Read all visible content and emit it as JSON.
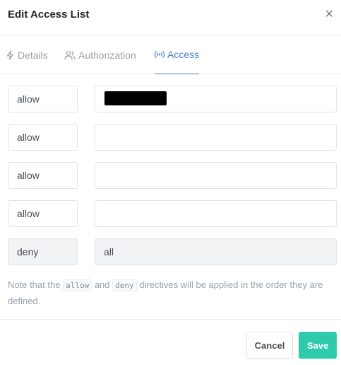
{
  "modal": {
    "title": "Edit Access List",
    "close_glyph": "×"
  },
  "tabs": [
    {
      "label": "Details",
      "icon": "bolt-icon",
      "active": false
    },
    {
      "label": "Authorization",
      "icon": "users-icon",
      "active": false
    },
    {
      "label": "Access",
      "icon": "broadcast-icon",
      "active": true
    }
  ],
  "rules": [
    {
      "directive": "allow",
      "address": "",
      "redacted": true
    },
    {
      "directive": "allow",
      "address": ""
    },
    {
      "directive": "allow",
      "address": ""
    },
    {
      "directive": "allow",
      "address": ""
    },
    {
      "directive": "deny",
      "address": "all",
      "disabled": true
    }
  ],
  "note": {
    "prefix": "Note that the",
    "code1": "allow",
    "middle": "and",
    "code2": "deny",
    "suffix": "directives will be applied in the order they are defined."
  },
  "footer": {
    "cancel_label": "Cancel",
    "save_label": "Save"
  },
  "colors": {
    "accent": "#467fcf",
    "save": "#2ecaac"
  }
}
